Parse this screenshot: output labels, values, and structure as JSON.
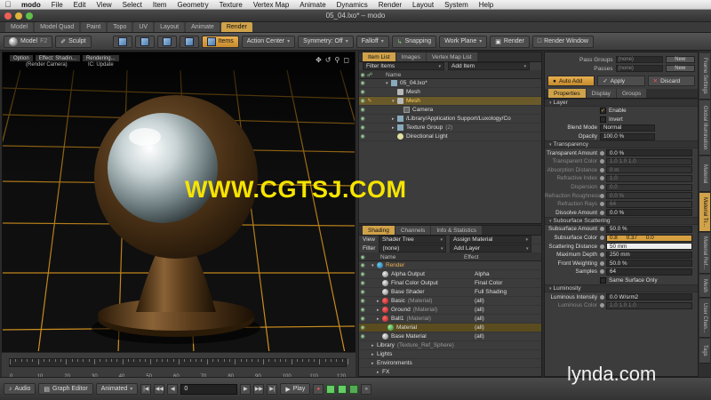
{
  "menubar": {
    "app": "modo",
    "items": [
      "File",
      "Edit",
      "View",
      "Select",
      "Item",
      "Geometry",
      "Texture",
      "Vertex Map",
      "Animate",
      "Dynamics",
      "Render",
      "Layout",
      "System",
      "Help"
    ]
  },
  "window": {
    "title": "05_04.lxo* – modo"
  },
  "layout_tabs": [
    "Model",
    "Model Quad",
    "Paint",
    "Topo",
    "UV",
    "Layout",
    "Animate",
    "Render"
  ],
  "layout_tabs_active": "Render",
  "toolbar": {
    "model": "Model",
    "model_key": "F2",
    "sculpt": "Sculpt",
    "items": "Items",
    "action_center": "Action Center",
    "symmetry": "Symmetry: Off",
    "falloff": "Falloff",
    "snapping": "Snapping",
    "work_plane": "Work Plane",
    "render": "Render",
    "render_window": "Render Window"
  },
  "viewport": {
    "options": "Option",
    "effect": "Effect: Shadin...",
    "rendering": "Rendering...",
    "sub1": "(Render Camera)",
    "sub2": "IC: Update"
  },
  "timeline": {
    "ticks": [
      "0",
      "10",
      "20",
      "30",
      "40",
      "50",
      "60",
      "70",
      "80",
      "90",
      "100",
      "110",
      "120"
    ]
  },
  "bottombar": {
    "audio": "Audio",
    "graph_editor": "Graph Editor",
    "animated": "Animated",
    "frame": "0",
    "play": "Play"
  },
  "item_list": {
    "tabs": [
      "Item List",
      "Images",
      "Vertex Map List"
    ],
    "filter": "Filter Items",
    "add_item": "Add Item",
    "col_name": "Name",
    "rows": [
      {
        "label": "05_04.lxo*",
        "indent": 2,
        "icon": "scene"
      },
      {
        "label": "Mesh",
        "indent": 3,
        "icon": "mesh"
      },
      {
        "label": "Mesh",
        "indent": 3,
        "icon": "mesh",
        "selected": true
      },
      {
        "label": "Camera",
        "indent": 4,
        "icon": "cam"
      },
      {
        "label": "/Library/Application Support/Luxology/Co",
        "indent": 3,
        "icon": "grp"
      },
      {
        "label": "Texture Group",
        "suffix": "(2)",
        "indent": 3,
        "icon": "grp"
      },
      {
        "label": "Directional Light",
        "indent": 3,
        "icon": "light"
      }
    ]
  },
  "shader_tree": {
    "tabs": [
      "Shading",
      "Channels",
      "Info & Statistics"
    ],
    "view_label": "View",
    "view_value": "Shader Tree",
    "assign_material": "Assign Material",
    "filter_label": "Filter",
    "filter_value": "(none)",
    "add_layer": "Add Layer",
    "col_name": "Name",
    "col_effect": "Effect",
    "rows": [
      {
        "label": "Render",
        "effect": "",
        "indent": 1,
        "icon": "orb",
        "orange": true
      },
      {
        "label": "Alpha Output",
        "effect": "Alpha",
        "indent": 2,
        "icon": "grey"
      },
      {
        "label": "Final Color Output",
        "effect": "Final Color",
        "indent": 2,
        "icon": "grey"
      },
      {
        "label": "Base Shader",
        "effect": "Full Shading",
        "indent": 2,
        "icon": "grey"
      },
      {
        "label": "Basic",
        "suffix": "(Material)",
        "effect": "(all)",
        "indent": 2,
        "icon": "ball"
      },
      {
        "label": "Ground",
        "suffix": "(Material)",
        "effect": "(all)",
        "indent": 2,
        "icon": "ball"
      },
      {
        "label": "Ball1",
        "suffix": "(Material)",
        "effect": "(all)",
        "indent": 2,
        "icon": "ball"
      },
      {
        "label": "Material",
        "suffix": "",
        "effect": "(all)",
        "indent": 3,
        "icon": "green",
        "selected": true
      },
      {
        "label": "Base Material",
        "effect": "(all)",
        "indent": 2,
        "icon": "grey"
      },
      {
        "label": "Library",
        "suffix": "(Texture_Ref_Sphere)",
        "effect": "",
        "indent": 1,
        "icon": "none"
      },
      {
        "label": "Lights",
        "effect": "",
        "indent": 1,
        "icon": "none"
      },
      {
        "label": "Environments",
        "effect": "",
        "indent": 1,
        "icon": "none"
      },
      {
        "label": "FX",
        "effect": "",
        "indent": 2,
        "icon": "none"
      }
    ]
  },
  "properties": {
    "pass_groups_label": "Pass Groups",
    "pass_groups_value": "(none)",
    "passes_label": "Passes",
    "passes_value": "(none)",
    "new": "New",
    "auto_add": "Auto Add",
    "apply": "Apply",
    "discard": "Discard",
    "tabs": [
      "Properties",
      "Display",
      "Groups"
    ],
    "layer": {
      "section": "Layer",
      "enable": "Enable",
      "invert": "Invert",
      "blend_mode_label": "Blend Mode",
      "blend_mode": "Normal",
      "opacity_label": "Opacity",
      "opacity": "100.0 %"
    },
    "transparency": {
      "section": "Transparency",
      "rows": [
        {
          "label": "Transparent Amount",
          "value": "0.0 %",
          "enabled": true
        },
        {
          "label": "Transparent Color",
          "value": "1.0    1.0    1.0",
          "enabled": false
        },
        {
          "label": "Absorption Distance",
          "value": "0 m",
          "enabled": false
        },
        {
          "label": "Refractive Index",
          "value": "1.0",
          "enabled": false
        },
        {
          "label": "Dispersion",
          "value": "0.0",
          "enabled": false
        },
        {
          "label": "Refraction Roughness",
          "value": "0.0 %",
          "enabled": false
        },
        {
          "label": "Refraction Rays",
          "value": "64",
          "enabled": false
        },
        {
          "label": "Dissolve Amount",
          "value": "0.0 %",
          "enabled": true
        }
      ]
    },
    "subsurface": {
      "section": "Subsurface Scattering",
      "amount_label": "Subsurface Amount",
      "amount": "50.0 %",
      "color_label": "Subsurface Color",
      "color_values": [
        "0.8",
        "0.37",
        "0.0"
      ],
      "distance_label": "Scattering Distance",
      "distance": "50 mm",
      "max_depth_label": "Maximum Depth",
      "max_depth": "250 mm",
      "front_label": "Front Weighting",
      "front": "50.0 %",
      "samples_label": "Samples",
      "samples": "64",
      "same_surface": "Same Surface Only"
    },
    "luminosity": {
      "section": "Luminosity",
      "intensity_label": "Luminous Intensity",
      "intensity": "0.0 W/srm2",
      "color_label": "Luminous Color",
      "color": "1.0    1.0    1.0"
    }
  },
  "side_tabs": [
    "Frame Settings",
    "Global Illumination",
    "Material",
    "Material Tr...",
    "Material Ref...",
    "Mesh",
    "User Chan...",
    "Tags"
  ],
  "side_tabs_active": "Material Tr...",
  "overlays": {
    "watermark": "WWW.CGTSJ.COM",
    "brand": "lynda.com"
  },
  "colors": {
    "accent": "#d0a24a",
    "grid": "#e8a020",
    "watermark": "#f6e400"
  }
}
